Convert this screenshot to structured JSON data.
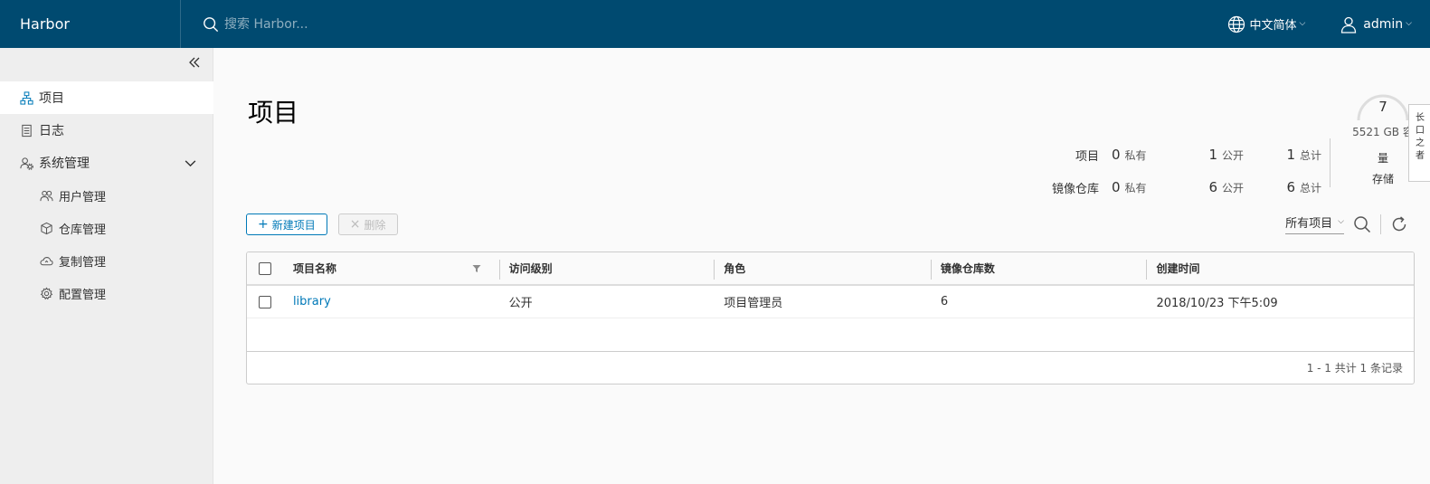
{
  "header": {
    "brand": "Harbor",
    "search_placeholder": "搜索 Harbor...",
    "language": "中文简体",
    "user": "admin"
  },
  "sidebar": {
    "items": [
      {
        "label": "项目",
        "icon": "project-icon",
        "active": true
      },
      {
        "label": "日志",
        "icon": "log-icon"
      },
      {
        "label": "系统管理",
        "icon": "admin-icon",
        "expanded": true
      }
    ],
    "sub_items": [
      {
        "label": "用户管理",
        "icon": "users-icon"
      },
      {
        "label": "仓库管理",
        "icon": "registry-icon"
      },
      {
        "label": "复制管理",
        "icon": "cloud-replication-icon"
      },
      {
        "label": "配置管理",
        "icon": "gear-icon"
      }
    ]
  },
  "main": {
    "title": "项目",
    "stats": {
      "projects_label": "项目",
      "repos_label": "镜像仓库",
      "private_unit": "私有",
      "public_unit": "公开",
      "total_unit": "总计",
      "projects": {
        "private": "0",
        "public": "1",
        "total": "1"
      },
      "repos": {
        "private": "0",
        "public": "6",
        "total": "6"
      }
    },
    "storage": {
      "value": "7",
      "capacity": "5521 GB 容",
      "label_line1": "量",
      "label_line2": "存储"
    },
    "edge_text": "长\n口\n之\n者",
    "toolbar": {
      "new_label": "新建项目",
      "delete_label": "删除"
    },
    "filter": {
      "selected": "所有项目"
    },
    "grid": {
      "columns": [
        "项目名称",
        "访问级别",
        "角色",
        "镜像仓库数",
        "创建时间"
      ],
      "rows": [
        {
          "name": "library",
          "access": "公开",
          "role": "项目管理员",
          "repos": "6",
          "created": "2018/10/23 下午5:09"
        }
      ],
      "footer": "1 - 1 共计 1 条记录"
    }
  },
  "colors": {
    "header_bg": "#004a70",
    "link": "#0079b8"
  }
}
